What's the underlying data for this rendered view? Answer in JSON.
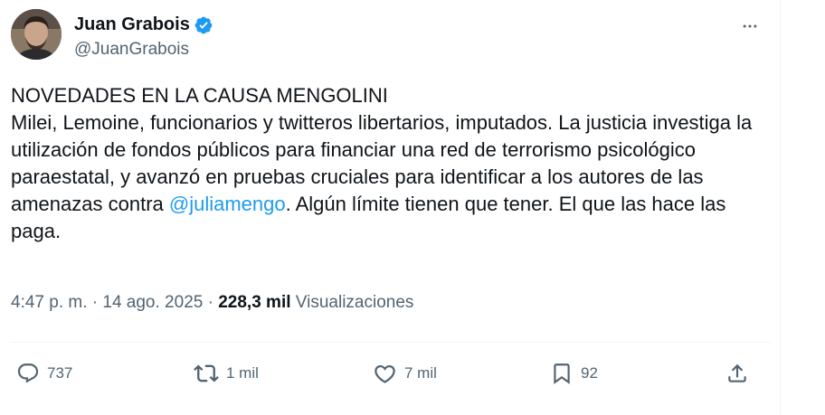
{
  "author": {
    "name": "Juan Grabois",
    "handle": "@JuanGrabois",
    "verified_color": "#1d9bf0"
  },
  "tweet": {
    "headline": "NOVEDADES EN LA CAUSA MENGOLINI",
    "text_before_mention": "Milei, Lemoine, funcionarios y twitteros libertarios, imputados. La justicia investiga la utilización de fondos públicos para financiar una red de terrorismo psicológico paraestatal, y avanzó en pruebas cruciales para identificar a los autores de las amenazas contra ",
    "mention": "@juliamengo",
    "text_after_mention": ". Algún límite tienen que tener. El que las hace las paga."
  },
  "meta": {
    "time": "4:47 p. m.",
    "separator": "·",
    "date": "14 ago. 2025",
    "views_count": "228,3 mil",
    "views_label": "Visualizaciones"
  },
  "actions": {
    "replies": "737",
    "reposts": "1 mil",
    "likes": "7 mil",
    "bookmarks": "92"
  },
  "icons": {
    "reply": "reply-icon",
    "repost": "repost-icon",
    "like": "heart-icon",
    "bookmark": "bookmark-icon",
    "share": "share-icon",
    "more": "more-icon",
    "verified": "verified-badge-icon"
  },
  "colors": {
    "accent": "#1d9bf0",
    "secondary_text": "#536471",
    "primary_text": "#0f1419"
  }
}
